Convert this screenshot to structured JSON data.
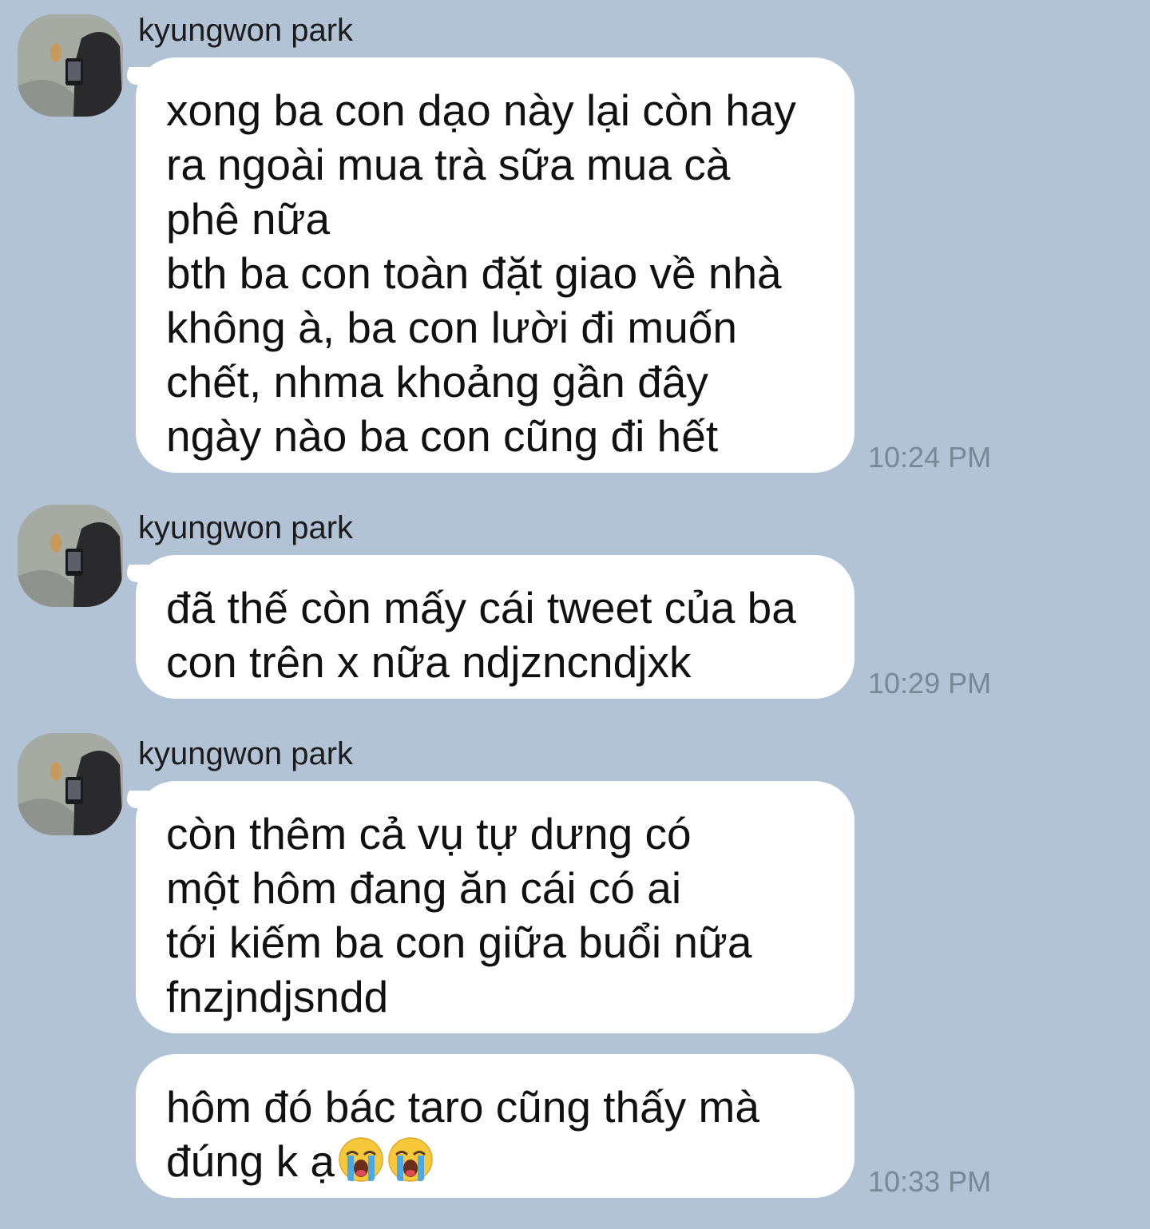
{
  "messages": [
    {
      "sender": "kyungwon park",
      "text": "xong ba con dạo này lại còn hay\nra ngoài mua trà sữa mua cà\nphê nữa\nbth ba con toàn đặt giao về nhà\nkhông à, ba con lười đi muốn\nchết, nhma khoảng gần đây\nngày nào ba con cũng đi hết",
      "time": "10:24 PM"
    },
    {
      "sender": "kyungwon park",
      "text": "đã thế còn mấy cái tweet của ba\ncon trên x nữa ndjzncndjxk",
      "time": "10:29 PM"
    },
    {
      "sender": "kyungwon park",
      "text": "còn thêm cả vụ tự dưng có\nmột hôm đang ăn cái có ai\ntới kiếm ba con giữa buổi nữa\nfnzjndjsndd",
      "time": ""
    },
    {
      "text": "hôm đó bác taro cũng thấy mà\nđúng k ạ",
      "emoji": [
        "loudly-crying-face",
        "loudly-crying-face"
      ],
      "time": "10:33 PM"
    }
  ],
  "colors": {
    "background": "#b2c3d6",
    "bubble": "#ffffff",
    "time_text": "#7a8796"
  }
}
